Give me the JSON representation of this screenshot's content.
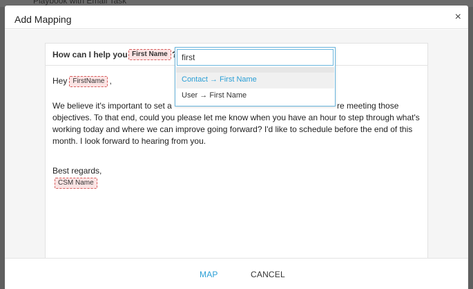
{
  "backdrop": {
    "text": "Playbook with Email Task"
  },
  "modal": {
    "title": "Add Mapping",
    "close_glyph": "×",
    "close_icon": "close-icon"
  },
  "editor": {
    "subject_label": "How can I help you",
    "subject_token": "First Name",
    "subject_suffix": "?",
    "greeting_prefix": "Hey",
    "greeting_token": "FirstName",
    "greeting_suffix": ",",
    "body_line1_start": "We believe it's important to set a",
    "body_line1_end": "re meeting those",
    "body_line2": "objectives. To that end, could you please let me know when you have an hour to step through what's",
    "body_line3": "working today and where we can improve going forward? I'd like to schedule before the end of this",
    "body_line4": "month. I look forward to hearing from you.",
    "signoff": "Best regards,",
    "signature_token": "CSM Name"
  },
  "dropdown": {
    "search_value": "first",
    "items": [
      {
        "label": "Contact → First Name",
        "highlighted": true
      },
      {
        "label": "User → First Name",
        "highlighted": false
      }
    ]
  },
  "footer": {
    "map_label": "MAP",
    "cancel_label": "CANCEL"
  },
  "colors": {
    "accent": "#2a9fd6",
    "token_border": "#d65a5a",
    "token_bg": "#fbe4e4",
    "dropdown_border": "#6ab6de"
  }
}
